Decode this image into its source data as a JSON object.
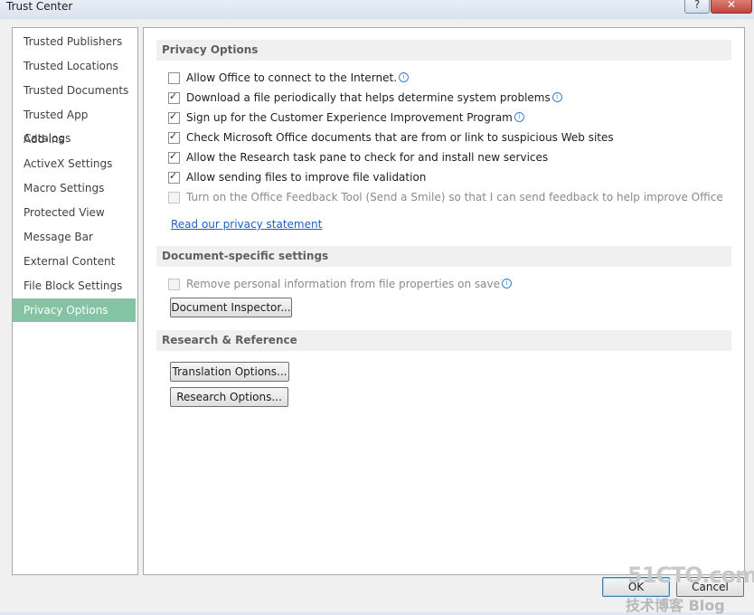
{
  "window": {
    "title": "Trust Center",
    "help_label": "?",
    "close_label": "✕"
  },
  "nav": {
    "items": [
      {
        "label": "Trusted Publishers"
      },
      {
        "label": "Trusted Locations"
      },
      {
        "label": "Trusted Documents"
      },
      {
        "label": "Trusted App Catalogs"
      },
      {
        "label": "Add-ins"
      },
      {
        "label": "ActiveX Settings"
      },
      {
        "label": "Macro Settings"
      },
      {
        "label": "Protected View"
      },
      {
        "label": "Message Bar"
      },
      {
        "label": "External Content"
      },
      {
        "label": "File Block Settings"
      },
      {
        "label": "Privacy Options"
      }
    ],
    "selected": "Privacy Options"
  },
  "privacy": {
    "header": "Privacy Options",
    "options": [
      {
        "label": "Allow Office to connect to the Internet.",
        "checked": false,
        "info": true
      },
      {
        "label": "Download a file periodically that helps determine system problems",
        "checked": true,
        "info": true
      },
      {
        "label": "Sign up for the Customer Experience Improvement Program",
        "checked": true,
        "info": true
      },
      {
        "label": "Check Microsoft Office documents that are from or link to suspicious Web sites",
        "checked": true,
        "info": false
      },
      {
        "label": "Allow the Research task pane to check for and install new services",
        "checked": true,
        "info": false
      },
      {
        "label": "Allow sending files to improve file validation",
        "checked": true,
        "info": false
      },
      {
        "label": "Turn on the Office Feedback Tool (Send a Smile) so that I can send feedback to help improve Office",
        "checked": false,
        "disabled": true,
        "info": false
      }
    ],
    "privacy_link": "Read our privacy statement"
  },
  "document_specific": {
    "header": "Document-specific settings",
    "remove_personal_info": {
      "label": "Remove personal information from file properties on save",
      "checked": false,
      "disabled": true
    },
    "inspector_button": "Document Inspector..."
  },
  "research": {
    "header": "Research & Reference",
    "translation_button": "Translation Options...",
    "research_button": "Research Options..."
  },
  "footer": {
    "ok_label": "OK",
    "cancel_label": "Cancel"
  },
  "watermark": {
    "text": "51CTO.com",
    "sub": "技术博客 Blog"
  }
}
